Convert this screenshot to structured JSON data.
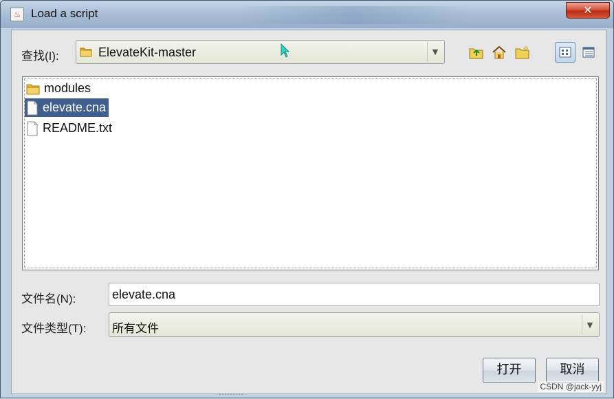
{
  "window": {
    "title": "Load a script",
    "close_label": "✕"
  },
  "look_in": {
    "label": "查找(I):",
    "value": "ElevateKit-master"
  },
  "toolbar": {
    "up_icon": "up-folder-icon",
    "home_icon": "home-icon",
    "new_folder_icon": "new-folder-icon",
    "list_view_icon": "list-view-icon",
    "details_view_icon": "details-view-icon"
  },
  "files": [
    {
      "name": "modules",
      "type": "folder",
      "selected": false
    },
    {
      "name": "elevate.cna",
      "type": "file",
      "selected": true
    },
    {
      "name": "README.txt",
      "type": "file",
      "selected": false
    }
  ],
  "file_name": {
    "label": "文件名(N):",
    "value": "elevate.cna"
  },
  "file_type": {
    "label": "文件类型(T):",
    "value": "所有文件"
  },
  "buttons": {
    "open": "打开",
    "cancel": "取消"
  },
  "watermark": "CSDN @jack-yyj",
  "colors": {
    "selection": "#3f5f8f",
    "close_button": "#c8402a",
    "folder": "#e8b93a"
  }
}
